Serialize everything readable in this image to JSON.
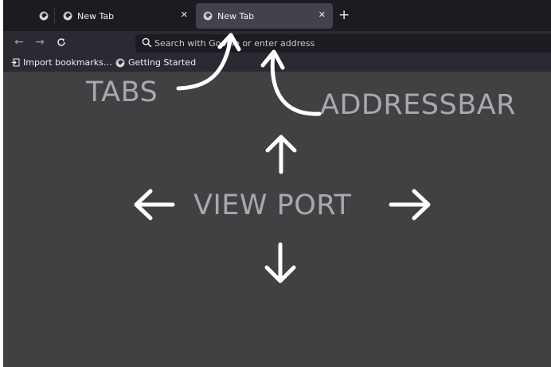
{
  "tabs": [
    {
      "label": "New Tab",
      "close": "✕"
    },
    {
      "label": "New Tab",
      "close": "✕",
      "active": true
    }
  ],
  "tabstrip": {
    "new_tab": "+"
  },
  "nav": {
    "back": "←",
    "forward": "→",
    "reload": "↻"
  },
  "urlbar": {
    "placeholder": "Search with Google or enter address",
    "value": ""
  },
  "bookmarks": [
    {
      "label": "Import bookmarks…",
      "icon": "import-icon"
    },
    {
      "label": "Getting Started",
      "icon": "firefox-icon"
    }
  ],
  "annotations": {
    "tabs": "TABS",
    "addressbar": "ADDRESSBAR",
    "viewport": "VIEW PORT"
  },
  "colors": {
    "tabstrip": "#1c1b22",
    "toolbar": "#2b2a33",
    "active_tab": "#42414d",
    "viewport": "#414143",
    "annotation_text": "#a9a9ad",
    "arrows": "#ffffff"
  }
}
